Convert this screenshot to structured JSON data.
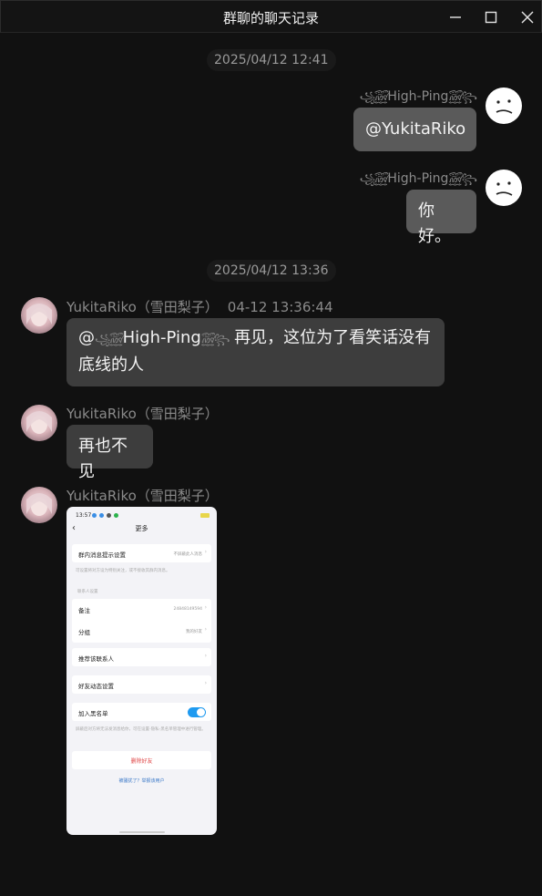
{
  "window": {
    "title": "群聊的聊天记录",
    "controls": {
      "minimize": "minimize-icon",
      "maximize": "maximize-icon",
      "close": "close-icon"
    }
  },
  "timestamps": [
    "2025/04/12 12:41",
    "2025/04/12 13:36"
  ],
  "self": {
    "nickname": "High-Ping",
    "deco_left": "꧁꫞",
    "deco_right": "꫞꧂",
    "messages": [
      "@YukitaRiko",
      "你好。"
    ]
  },
  "other": {
    "sender": "YukitaRiko（雪田梨子）",
    "time": "04-12 13:36:44",
    "message1_mention": "@",
    "message1_mention_name": "High-Ping",
    "message1_rest": " 再见，这位为了看笑话没有底线的人",
    "message2": "再也不见"
  },
  "screenshot": {
    "status_time": "13:57",
    "page_title": "更多",
    "rows": {
      "group_tip": "群内消息提示设置",
      "group_tip_value": "不屏蔽此人消息",
      "group_tip_note": "可设置将对方设为特别关注，或不接收其群内消息。",
      "section_contact": "联系人设置",
      "remark": "备注",
      "remark_value": "24848149594",
      "group": "分组",
      "group_value": "我的好友",
      "recommend": "推荐该联系人",
      "moments": "好友动态设置",
      "blacklist": "加入黑名单",
      "blacklist_note": "屏蔽后对方将无法发消息给你，可在设置-隐私-黑名单管理中进行管理。",
      "delete": "删除好友",
      "report": "被骚扰了？举报该用户"
    }
  },
  "colors": {
    "background": "#111111",
    "self_bubble": "#5a5a5a",
    "other_bubble": "#3d3d3d",
    "toggle_on": "#1e9af0",
    "danger": "#e04848"
  }
}
